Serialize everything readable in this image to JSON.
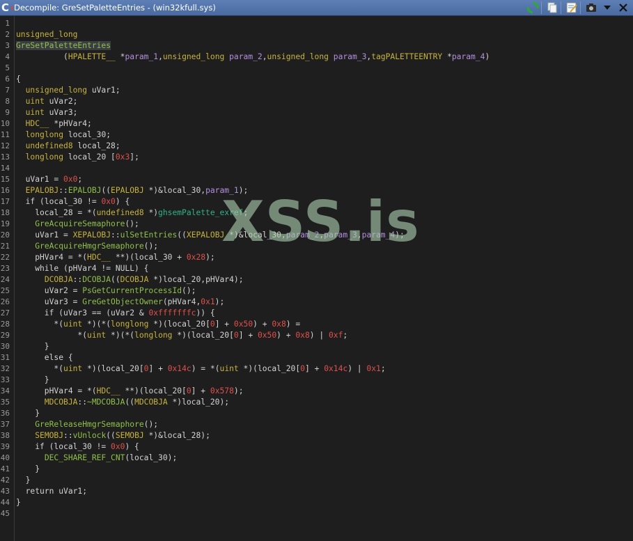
{
  "window": {
    "title": "Decompile: GreSetPaletteEntries -  (win32kfull.sys)",
    "icon": "decompile-c-icon"
  },
  "toolbar": [
    {
      "name": "refresh-button",
      "icon": "refresh-icon"
    },
    {
      "name": "copy-button",
      "icon": "copy-icon"
    },
    {
      "name": "edit-function-signature-button",
      "icon": "edit-signature-icon"
    },
    {
      "name": "snapshot-button",
      "icon": "camera-icon"
    },
    {
      "name": "menu-button",
      "icon": "chevron-down-icon"
    },
    {
      "name": "close-button",
      "icon": "close-icon"
    }
  ],
  "watermark": "XSS.is",
  "colors": {
    "type": "#c8b33c",
    "function": "#8fc04a",
    "number": "#e0504c",
    "param": "#b38fe0",
    "global": "#2fb28a",
    "text": "#d4d4d4"
  },
  "code_lines": [
    [],
    [
      [
        "type",
        "unsigned_long"
      ]
    ],
    [
      [
        "fn",
        "GreSetPaletteEntries"
      ]
    ],
    [
      [
        "plain",
        "          ("
      ],
      [
        "type",
        "HPALETTE__"
      ],
      [
        "plain",
        " *"
      ],
      [
        "param",
        "param_1"
      ],
      [
        "plain",
        ","
      ],
      [
        "type",
        "unsigned_long"
      ],
      [
        "plain",
        " "
      ],
      [
        "param",
        "param_2"
      ],
      [
        "plain",
        ","
      ],
      [
        "type",
        "unsigned_long"
      ],
      [
        "plain",
        " "
      ],
      [
        "param",
        "param_3"
      ],
      [
        "plain",
        ","
      ],
      [
        "type",
        "tagPALETTEENTRY"
      ],
      [
        "plain",
        " *"
      ],
      [
        "param",
        "param_4"
      ],
      [
        "plain",
        ")"
      ]
    ],
    [],
    [
      [
        "plain",
        "{"
      ]
    ],
    [
      [
        "plain",
        "  "
      ],
      [
        "type",
        "unsigned_long"
      ],
      [
        "plain",
        " uVar1;"
      ]
    ],
    [
      [
        "plain",
        "  "
      ],
      [
        "type",
        "uint"
      ],
      [
        "plain",
        " uVar2;"
      ]
    ],
    [
      [
        "plain",
        "  "
      ],
      [
        "type",
        "uint"
      ],
      [
        "plain",
        " uVar3;"
      ]
    ],
    [
      [
        "plain",
        "  "
      ],
      [
        "type",
        "HDC__"
      ],
      [
        "plain",
        " *pHVar4;"
      ]
    ],
    [
      [
        "plain",
        "  "
      ],
      [
        "type",
        "longlong"
      ],
      [
        "plain",
        " local_30;"
      ]
    ],
    [
      [
        "plain",
        "  "
      ],
      [
        "type",
        "undefined8"
      ],
      [
        "plain",
        " local_28;"
      ]
    ],
    [
      [
        "plain",
        "  "
      ],
      [
        "type",
        "longlong"
      ],
      [
        "plain",
        " local_20 ["
      ],
      [
        "num",
        "0x3"
      ],
      [
        "plain",
        "];"
      ]
    ],
    [],
    [
      [
        "plain",
        "  uVar1 = "
      ],
      [
        "num",
        "0x0"
      ],
      [
        "plain",
        ";"
      ]
    ],
    [
      [
        "plain",
        "  "
      ],
      [
        "type",
        "EPALOBJ"
      ],
      [
        "plain",
        "::"
      ],
      [
        "fn",
        "EPALOBJ"
      ],
      [
        "plain",
        "(("
      ],
      [
        "type",
        "EPALOBJ"
      ],
      [
        "plain",
        " *)&local_30,"
      ],
      [
        "param",
        "param_1"
      ],
      [
        "plain",
        ");"
      ]
    ],
    [
      [
        "plain",
        "  if (local_30 != "
      ],
      [
        "num",
        "0x0"
      ],
      [
        "plain",
        ") {"
      ]
    ],
    [
      [
        "plain",
        "    local_28 = *("
      ],
      [
        "type",
        "undefined8"
      ],
      [
        "plain",
        " *)"
      ],
      [
        "glob",
        "ghsemPalette_exref"
      ],
      [
        "plain",
        ";"
      ]
    ],
    [
      [
        "plain",
        "    "
      ],
      [
        "fn",
        "GreAcquireSemaphore"
      ],
      [
        "plain",
        "();"
      ]
    ],
    [
      [
        "plain",
        "    uVar1 = "
      ],
      [
        "type",
        "XEPALOBJ"
      ],
      [
        "plain",
        "::"
      ],
      [
        "fn",
        "ulSetEntries"
      ],
      [
        "plain",
        "(("
      ],
      [
        "type",
        "XEPALOBJ"
      ],
      [
        "plain",
        " *)&local_30,"
      ],
      [
        "param",
        "param_2"
      ],
      [
        "plain",
        ","
      ],
      [
        "param",
        "param_3"
      ],
      [
        "plain",
        ","
      ],
      [
        "param",
        "param_4"
      ],
      [
        "plain",
        ");"
      ]
    ],
    [
      [
        "plain",
        "    "
      ],
      [
        "fn",
        "GreAcquireHmgrSemaphore"
      ],
      [
        "plain",
        "();"
      ]
    ],
    [
      [
        "plain",
        "    pHVar4 = *("
      ],
      [
        "type",
        "HDC__"
      ],
      [
        "plain",
        " **)(local_30 + "
      ],
      [
        "num",
        "0x28"
      ],
      [
        "plain",
        ");"
      ]
    ],
    [
      [
        "plain",
        "    while (pHVar4 != NULL) {"
      ]
    ],
    [
      [
        "plain",
        "      "
      ],
      [
        "type",
        "DCOBJA"
      ],
      [
        "plain",
        "::"
      ],
      [
        "fn",
        "DCOBJA"
      ],
      [
        "plain",
        "(("
      ],
      [
        "type",
        "DCOBJA"
      ],
      [
        "plain",
        " *)local_20,pHVar4);"
      ]
    ],
    [
      [
        "plain",
        "      uVar2 = "
      ],
      [
        "fn",
        "PsGetCurrentProcessId"
      ],
      [
        "plain",
        "();"
      ]
    ],
    [
      [
        "plain",
        "      uVar3 = "
      ],
      [
        "fn",
        "GreGetObjectOwner"
      ],
      [
        "plain",
        "(pHVar4,"
      ],
      [
        "num",
        "0x1"
      ],
      [
        "plain",
        ");"
      ]
    ],
    [
      [
        "plain",
        "      if (uVar3 == (uVar2 & "
      ],
      [
        "num",
        "0xfffffffc"
      ],
      [
        "plain",
        ")) {"
      ]
    ],
    [
      [
        "plain",
        "        *("
      ],
      [
        "type",
        "uint"
      ],
      [
        "plain",
        " *)(*("
      ],
      [
        "type",
        "longlong"
      ],
      [
        "plain",
        " *)(local_20["
      ],
      [
        "num",
        "0"
      ],
      [
        "plain",
        "] + "
      ],
      [
        "num",
        "0x50"
      ],
      [
        "plain",
        ") + "
      ],
      [
        "num",
        "0x8"
      ],
      [
        "plain",
        ") ="
      ]
    ],
    [
      [
        "plain",
        "             *("
      ],
      [
        "type",
        "uint"
      ],
      [
        "plain",
        " *)(*("
      ],
      [
        "type",
        "longlong"
      ],
      [
        "plain",
        " *)(local_20["
      ],
      [
        "num",
        "0"
      ],
      [
        "plain",
        "] + "
      ],
      [
        "num",
        "0x50"
      ],
      [
        "plain",
        ") + "
      ],
      [
        "num",
        "0x8"
      ],
      [
        "plain",
        ") | "
      ],
      [
        "num",
        "0xf"
      ],
      [
        "plain",
        ";"
      ]
    ],
    [
      [
        "plain",
        "      }"
      ]
    ],
    [
      [
        "plain",
        "      else {"
      ]
    ],
    [
      [
        "plain",
        "        *("
      ],
      [
        "type",
        "uint"
      ],
      [
        "plain",
        " *)(local_20["
      ],
      [
        "num",
        "0"
      ],
      [
        "plain",
        "] + "
      ],
      [
        "num",
        "0x14c"
      ],
      [
        "plain",
        ") = *("
      ],
      [
        "type",
        "uint"
      ],
      [
        "plain",
        " *)(local_20["
      ],
      [
        "num",
        "0"
      ],
      [
        "plain",
        "] + "
      ],
      [
        "num",
        "0x14c"
      ],
      [
        "plain",
        ") | "
      ],
      [
        "num",
        "0x1"
      ],
      [
        "plain",
        ";"
      ]
    ],
    [
      [
        "plain",
        "      }"
      ]
    ],
    [
      [
        "plain",
        "      pHVar4 = *("
      ],
      [
        "type",
        "HDC__"
      ],
      [
        "plain",
        " **)(local_20["
      ],
      [
        "num",
        "0"
      ],
      [
        "plain",
        "] + "
      ],
      [
        "num",
        "0x578"
      ],
      [
        "plain",
        ");"
      ]
    ],
    [
      [
        "plain",
        "      "
      ],
      [
        "type",
        "MDCOBJA"
      ],
      [
        "plain",
        "::"
      ],
      [
        "fn",
        "~MDCOBJA"
      ],
      [
        "plain",
        "(("
      ],
      [
        "type",
        "MDCOBJA"
      ],
      [
        "plain",
        " *)local_20);"
      ]
    ],
    [
      [
        "plain",
        "    }"
      ]
    ],
    [
      [
        "plain",
        "    "
      ],
      [
        "fn",
        "GreReleaseHmgrSemaphore"
      ],
      [
        "plain",
        "();"
      ]
    ],
    [
      [
        "plain",
        "    "
      ],
      [
        "type",
        "SEMOBJ"
      ],
      [
        "plain",
        "::"
      ],
      [
        "fn",
        "vUnlock"
      ],
      [
        "plain",
        "(("
      ],
      [
        "type",
        "SEMOBJ"
      ],
      [
        "plain",
        " *)&local_28);"
      ]
    ],
    [
      [
        "plain",
        "    if (local_30 != "
      ],
      [
        "num",
        "0x0"
      ],
      [
        "plain",
        ") {"
      ]
    ],
    [
      [
        "plain",
        "      "
      ],
      [
        "fn",
        "DEC_SHARE_REF_CNT"
      ],
      [
        "plain",
        "(local_30);"
      ]
    ],
    [
      [
        "plain",
        "    }"
      ]
    ],
    [
      [
        "plain",
        "  }"
      ]
    ],
    [
      [
        "plain",
        "  return uVar1;"
      ]
    ],
    [
      [
        "plain",
        "}"
      ]
    ],
    []
  ]
}
